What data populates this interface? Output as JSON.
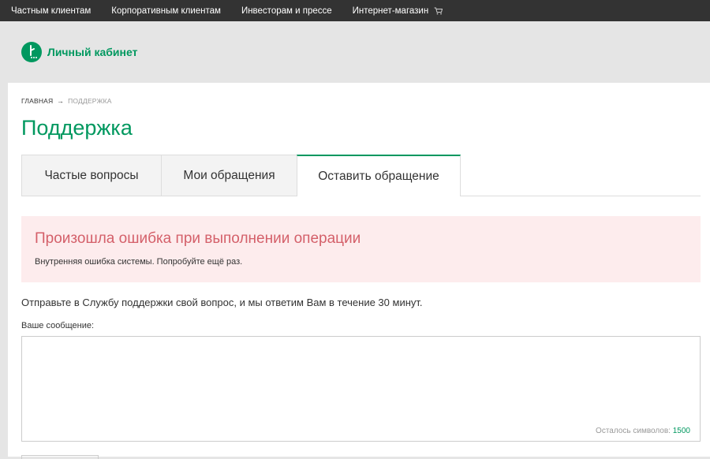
{
  "topnav": {
    "items": [
      {
        "label": "Частным клиентам"
      },
      {
        "label": "Корпоративным клиентам"
      },
      {
        "label": "Инвесторам и прессе"
      },
      {
        "label": "Интернет-магазин",
        "icon": "cart-icon"
      }
    ]
  },
  "header": {
    "logo_text": "Личный кабинет"
  },
  "breadcrumb": {
    "home": "ГЛАВНАЯ",
    "separator": "→",
    "current": "ПОДДЕРЖКА"
  },
  "page": {
    "title": "Поддержка"
  },
  "tabs": [
    {
      "label": "Частые вопросы"
    },
    {
      "label": "Мои обращения"
    },
    {
      "label": "Оставить обращение",
      "active": true
    }
  ],
  "alert": {
    "title": "Произошла ошибка при выполнении операции",
    "text": "Внутренняя ошибка системы. Попробуйте ещё раз."
  },
  "form": {
    "intro": "Отправьте в Службу поддержки свой вопрос, и мы ответим Вам в течение 30 минут.",
    "message_label": "Ваше сообщение:",
    "message_value": "",
    "counter_label": "Осталось символов:",
    "counter_value": "1500"
  },
  "colors": {
    "brand": "#00985f",
    "error": "#d4606a",
    "error_bg": "#fdeced",
    "topbar": "#333333"
  }
}
